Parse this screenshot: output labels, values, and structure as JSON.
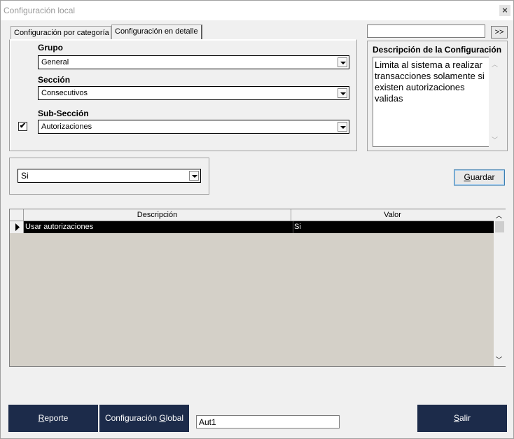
{
  "window": {
    "title": "Configuración local",
    "close_label": "×"
  },
  "tabs": [
    {
      "label": "Configuración por categoría",
      "active": false
    },
    {
      "label": "Configuración en detalle",
      "active": true
    }
  ],
  "fields": {
    "grupo": {
      "label": "Grupo",
      "value": "General"
    },
    "seccion": {
      "label": "Sección",
      "value": "Consecutivos"
    },
    "subseccion": {
      "label": "Sub-Sección",
      "value": "Autorizaciones",
      "checked": true,
      "check_glyph": "✔"
    }
  },
  "search": {
    "value": "",
    "button_label": ">>"
  },
  "description": {
    "title": "Descripción de la Configuración",
    "text": "Limita al sistema a realizar transacciones solamente si existen autorizaciones validas"
  },
  "value_select": {
    "value": "Si"
  },
  "guardar": {
    "pre": "",
    "accel": "G",
    "post": "uardar"
  },
  "grid": {
    "columns": [
      "Descripción",
      "Valor"
    ],
    "rows": [
      {
        "descripcion": "Usar autorizaciones",
        "valor": "Si",
        "selected": true
      }
    ]
  },
  "bottom": {
    "reporte": {
      "accel": "R",
      "post": "eporte"
    },
    "config_global": {
      "pre": "Configuración ",
      "accel": "G",
      "post": "lobal"
    },
    "code_input": {
      "value": "Aut1"
    },
    "salir": {
      "accel": "S",
      "post": "alir"
    }
  },
  "colors": {
    "dark_button": "#1c2b4a",
    "grid_bg": "#d4d0c8",
    "selected_row": "#000000"
  }
}
